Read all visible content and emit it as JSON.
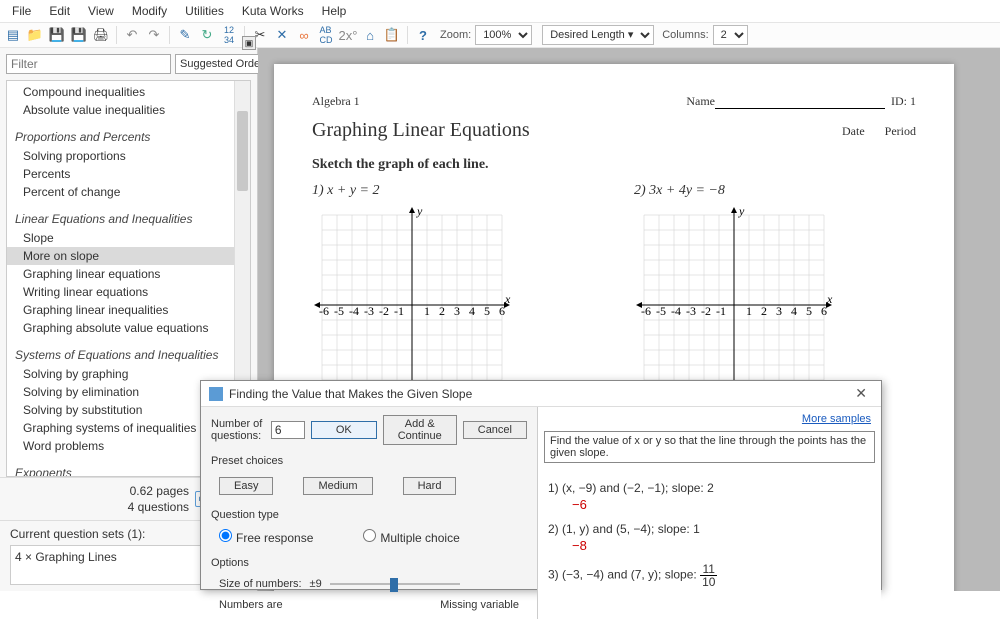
{
  "menu": [
    "File",
    "Edit",
    "View",
    "Modify",
    "Utilities",
    "Kuta Works",
    "Help"
  ],
  "toolbar": {
    "zoom_label": "Zoom:",
    "zoom_value": "100%",
    "length_label": "Desired Length ▾",
    "columns_label": "Columns:",
    "columns_value": "2"
  },
  "sidebar": {
    "filter_placeholder": "Filter",
    "order": "Suggested Order",
    "topics": [
      {
        "type": "item",
        "label": "Compound inequalities"
      },
      {
        "type": "item",
        "label": "Absolute value inequalities"
      },
      {
        "type": "gap"
      },
      {
        "type": "cat",
        "label": "Proportions and Percents"
      },
      {
        "type": "item",
        "label": "Solving proportions"
      },
      {
        "type": "item",
        "label": "Percents"
      },
      {
        "type": "item",
        "label": "Percent of change"
      },
      {
        "type": "gap"
      },
      {
        "type": "cat",
        "label": "Linear Equations and Inequalities"
      },
      {
        "type": "item",
        "label": "Slope"
      },
      {
        "type": "item",
        "label": "More on slope",
        "sel": true
      },
      {
        "type": "item",
        "label": "Graphing linear equations"
      },
      {
        "type": "item",
        "label": "Writing linear equations"
      },
      {
        "type": "item",
        "label": "Graphing linear inequalities"
      },
      {
        "type": "item",
        "label": "Graphing absolute value equations"
      },
      {
        "type": "gap"
      },
      {
        "type": "cat",
        "label": "Systems of Equations and Inequalities"
      },
      {
        "type": "item",
        "label": "Solving by graphing"
      },
      {
        "type": "item",
        "label": "Solving by elimination"
      },
      {
        "type": "item",
        "label": "Solving by substitution"
      },
      {
        "type": "item",
        "label": "Graphing systems of inequalities"
      },
      {
        "type": "item",
        "label": "Word problems"
      },
      {
        "type": "gap"
      },
      {
        "type": "cat",
        "label": "Exponents"
      }
    ],
    "pages": "0.62 pages",
    "questions": "4 questions",
    "qs_title": "Current question sets (1):",
    "qs_item": "4 × Graphing Lines"
  },
  "doc": {
    "course": "Algebra 1",
    "name_lbl": "Name",
    "id_lbl": "ID: 1",
    "title": "Graphing Linear Equations",
    "date_lbl": "Date",
    "period_lbl": "Period",
    "instr": "Sketch the graph of each line.",
    "p1": "1)  x + y = 2",
    "p2": "2)  3x + 4y = −8"
  },
  "dialog": {
    "title": "Finding the Value that Makes the Given Slope",
    "num_lbl": "Number of questions:",
    "num_val": "6",
    "ok": "OK",
    "add": "Add & Continue",
    "cancel": "Cancel",
    "more": "More samples",
    "preset": "Preset choices",
    "easy": "Easy",
    "med": "Medium",
    "hard": "Hard",
    "qt": "Question type",
    "free": "Free response",
    "mc": "Multiple choice",
    "opts": "Options",
    "size_lbl": "Size of numbers:",
    "size_val": "±9",
    "numbers_are": "Numbers are",
    "missing": "Missing variable",
    "desc": "Find the value of x or y so that the line through the points has the given slope.",
    "s1": "1)  (x, −9) and (−2, −1);  slope: 2",
    "a1": "−6",
    "s2": "2)  (1, y) and (5, −4);  slope: 1",
    "a2": "−8",
    "s3_pre": "3)  (−3, −4) and (7, y);  slope: ",
    "s3_num": "11",
    "s3_den": "10"
  }
}
